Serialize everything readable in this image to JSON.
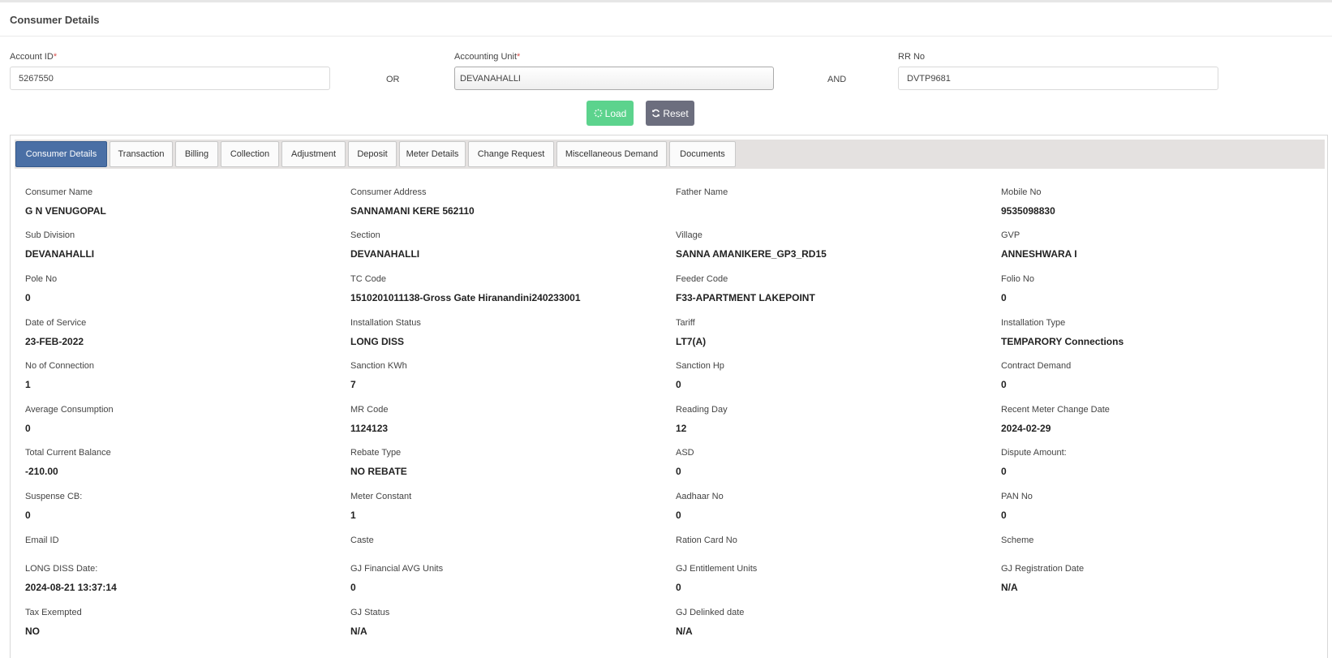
{
  "page": {
    "title": "Consumer Details"
  },
  "search": {
    "account_id": {
      "label": "Account ID",
      "required_mark": "*",
      "value": "5267550"
    },
    "or_text": "OR",
    "accounting_unit": {
      "label": "Accounting Unit",
      "required_mark": "*",
      "value": "DEVANAHALLI"
    },
    "and_text": "AND",
    "rr_no": {
      "label": "RR No",
      "value": "DVTP9681"
    },
    "load_label": "Load",
    "reset_label": "Reset"
  },
  "tabs": [
    {
      "label": "Consumer Details",
      "active": true
    },
    {
      "label": "Transaction"
    },
    {
      "label": "Billing"
    },
    {
      "label": "Collection"
    },
    {
      "label": "Adjustment"
    },
    {
      "label": "Deposit"
    },
    {
      "label": "Meter Details"
    },
    {
      "label": "Change Request"
    },
    {
      "label": "Miscellaneous Demand"
    },
    {
      "label": "Documents"
    }
  ],
  "details": [
    [
      {
        "label": "Consumer Name",
        "value": "G N VENUGOPAL"
      },
      {
        "label": "Consumer Address",
        "value": "SANNAMANI KERE 562110"
      },
      {
        "label": "Father Name",
        "value": ""
      },
      {
        "label": "Mobile No",
        "value": "9535098830"
      }
    ],
    [
      {
        "label": "Sub Division",
        "value": "DEVANAHALLI"
      },
      {
        "label": "Section",
        "value": "DEVANAHALLI"
      },
      {
        "label": "Village",
        "value": "SANNA AMANIKERE_GP3_RD15"
      },
      {
        "label": "GVP",
        "value": "ANNESHWARA I"
      }
    ],
    [
      {
        "label": "Pole No",
        "value": "0"
      },
      {
        "label": "TC Code",
        "value": "1510201011138-Gross Gate Hiranandini240233001"
      },
      {
        "label": "Feeder Code",
        "value": "F33-APARTMENT LAKEPOINT"
      },
      {
        "label": "Folio No",
        "value": "0"
      }
    ],
    [
      {
        "label": "Date of Service",
        "value": "23-FEB-2022"
      },
      {
        "label": "Installation Status",
        "value": "LONG DISS"
      },
      {
        "label": "Tariff",
        "value": "LT7(A)"
      },
      {
        "label": "Installation Type",
        "value": "TEMPARORY Connections"
      }
    ],
    [
      {
        "label": "No of Connection",
        "value": "1"
      },
      {
        "label": "Sanction KWh",
        "value": "7"
      },
      {
        "label": "Sanction Hp",
        "value": "0"
      },
      {
        "label": "Contract Demand",
        "value": "0"
      }
    ],
    [
      {
        "label": "Average Consumption",
        "value": "0"
      },
      {
        "label": "MR Code",
        "value": "1124123"
      },
      {
        "label": "Reading Day",
        "value": "12"
      },
      {
        "label": "Recent Meter Change Date",
        "value": "2024-02-29"
      }
    ],
    [
      {
        "label": "Total Current Balance",
        "value": "-210.00"
      },
      {
        "label": "Rebate Type",
        "value": "NO REBATE"
      },
      {
        "label": "ASD",
        "value": "0"
      },
      {
        "label": "Dispute Amount:",
        "value": "0"
      }
    ],
    [
      {
        "label": "Suspense CB:",
        "value": "0"
      },
      {
        "label": "Meter Constant",
        "value": "1"
      },
      {
        "label": "Aadhaar No",
        "value": "0"
      },
      {
        "label": "PAN No",
        "value": "0"
      }
    ],
    [
      {
        "label": "Email ID",
        "value": ""
      },
      {
        "label": "Caste",
        "value": ""
      },
      {
        "label": "Ration Card No",
        "value": ""
      },
      {
        "label": "Scheme",
        "value": ""
      }
    ],
    [
      {
        "label": "LONG DISS Date:",
        "value": "2024-08-21 13:37:14"
      },
      {
        "label": "GJ Financial AVG Units",
        "value": "0"
      },
      {
        "label": "GJ Entitlement Units",
        "value": "0"
      },
      {
        "label": "GJ Registration Date",
        "value": "N/A"
      }
    ],
    [
      {
        "label": "Tax Exempted",
        "value": "NO"
      },
      {
        "label": "GJ Status",
        "value": "N/A"
      },
      {
        "label": "GJ Delinked date",
        "value": "N/A"
      }
    ]
  ]
}
